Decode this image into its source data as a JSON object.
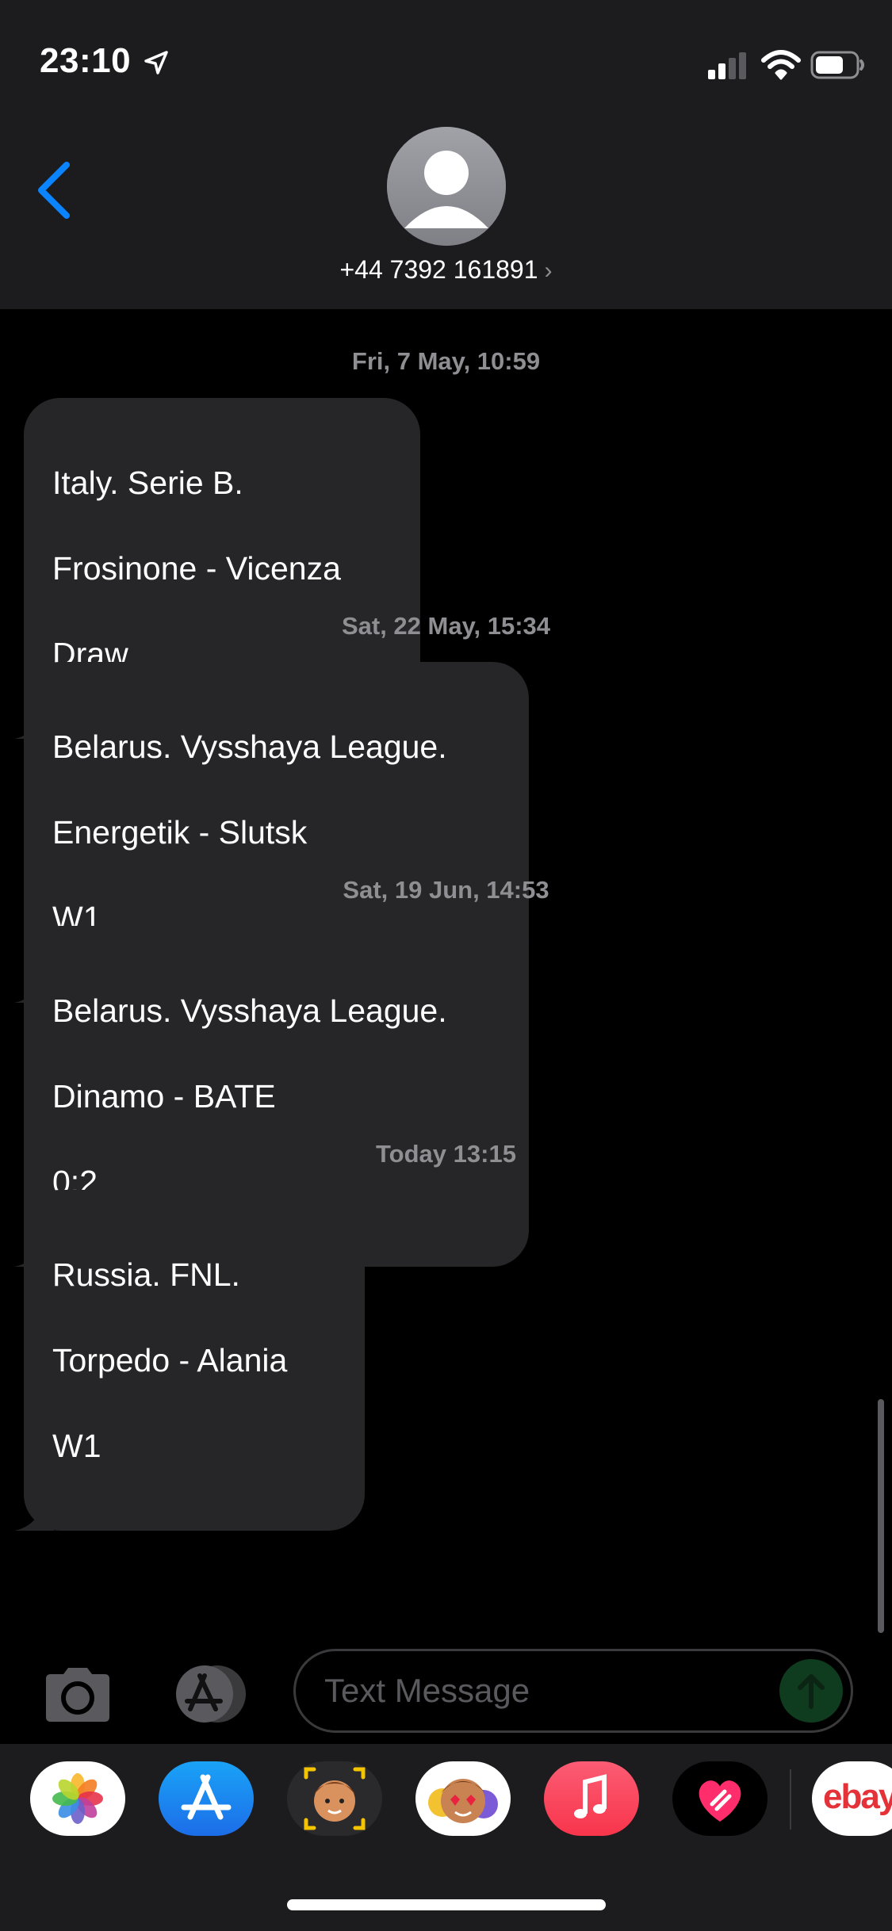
{
  "status_bar": {
    "time": "23:10"
  },
  "header": {
    "contact_number": "+44 7392 161891",
    "chevron": "›"
  },
  "thread": [
    {
      "timestamp": "Fri, 7 May, 10:59",
      "lines": [
        "Italy. Serie B.",
        "Frosinone - Vicenza",
        "Draw"
      ]
    },
    {
      "timestamp": "Sat, 22 May, 15:34",
      "lines": [
        "Belarus. Vysshaya League.",
        "Energetik - Slutsk",
        "W1"
      ]
    },
    {
      "timestamp": "Sat, 19 Jun, 14:53",
      "lines": [
        "Belarus. Vysshaya League.",
        "Dinamo - BATE",
        "0:2"
      ]
    },
    {
      "timestamp": "Today 13:15",
      "lines": [
        "Russia. FNL.",
        "Torpedo - Alania",
        "W1"
      ]
    }
  ],
  "compose": {
    "placeholder": "Text Message"
  },
  "app_tray": {
    "ebay_text": "ebay"
  },
  "colors": {
    "accent": "#0a84ff",
    "bubble": "#262628",
    "header_bg": "#1c1c1e",
    "timestamp": "#8e8e93"
  }
}
